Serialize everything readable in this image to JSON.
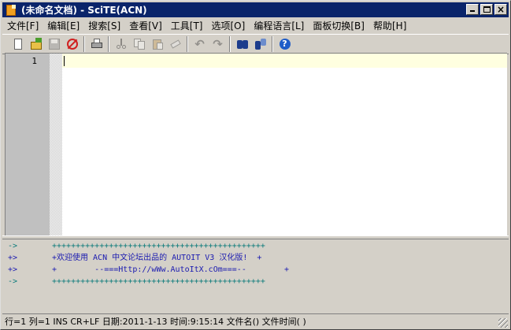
{
  "window": {
    "title": "(未命名文档) - SciTE(ACN)"
  },
  "menu": [
    "文件[F]",
    "编辑[E]",
    "搜索[S]",
    "查看[V]",
    "工具[T]",
    "选项[O]",
    "编程语言[L]",
    "面板切换[B]",
    "帮助[H]"
  ],
  "toolbar": {
    "icons": [
      "new-file-icon",
      "open-file-icon",
      "save-icon",
      "close-file-icon",
      "print-icon",
      "cut-icon",
      "copy-icon",
      "paste-icon",
      "erase-icon",
      "undo-icon",
      "redo-icon",
      "find-icon",
      "replace-icon",
      "help-icon"
    ]
  },
  "editor": {
    "line_number": "1"
  },
  "output": {
    "lines": [
      {
        "arrow": "->",
        "text": "+++++++++++++++++++++++++++++++++++++++++++++"
      },
      {
        "arrow": "+>",
        "text": "+欢迎使用 ACN 中文论坛出品的 AUTOIT V3 汉化版!  +"
      },
      {
        "arrow": "+>",
        "text": "+        --===Http://wWw.AutoItX.cOm===--        +"
      },
      {
        "arrow": "->",
        "text": "+++++++++++++++++++++++++++++++++++++++++++++"
      }
    ]
  },
  "status": {
    "text": "行=1 列=1 INS CR+LF  日期:2011-1-13 时间:9:15:14 文件名() 文件时间(  )"
  },
  "colors": {
    "titlebar": "#0a246a",
    "caret_line": "#ffffe0",
    "output_teal": "#0a7a7a",
    "output_blue": "#1a1ab0"
  }
}
